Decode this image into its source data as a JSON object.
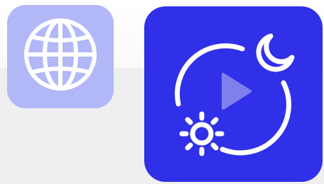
{
  "colors": {
    "globe_tile_bg": "#b1b7f7",
    "media_tile_bg": "#3030e8",
    "icon_stroke": "#ffffff",
    "play_fill": "#7f80ec"
  },
  "icons": {
    "globe": "globe-icon",
    "media": "day-night-play-icon",
    "moon": "moon-icon",
    "sun": "sun-icon",
    "play": "play-icon"
  }
}
